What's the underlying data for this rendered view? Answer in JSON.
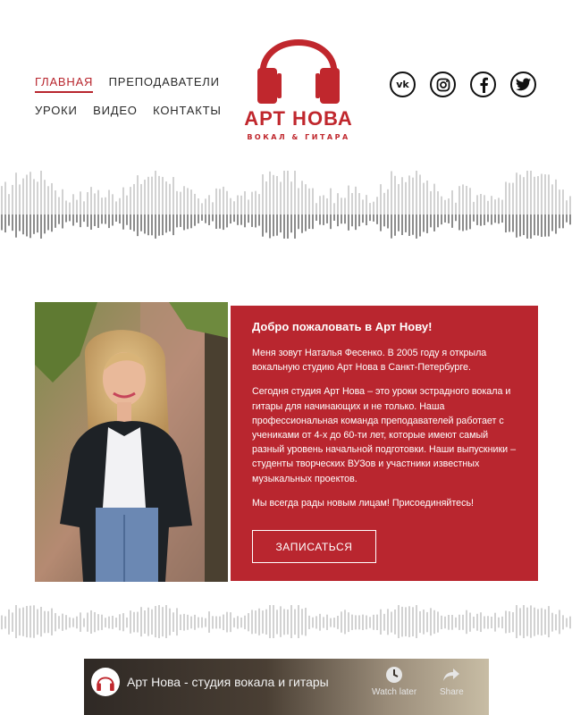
{
  "nav": {
    "row1": [
      {
        "label": "ГЛАВНАЯ",
        "active": true
      },
      {
        "label": "ПРЕПОДАВАТЕЛИ",
        "active": false
      }
    ],
    "row2": [
      {
        "label": "УРОКИ",
        "active": false
      },
      {
        "label": "ВИДЕО",
        "active": false
      },
      {
        "label": "КОНТАКТЫ",
        "active": false
      }
    ]
  },
  "logo": {
    "title": "АРТ НОВА",
    "subtitle": "ВОКАЛ & ГИТАРА",
    "icon": "headphones-icon"
  },
  "socials": [
    {
      "name": "vk-icon",
      "glyph": "vk"
    },
    {
      "name": "instagram-icon"
    },
    {
      "name": "facebook-icon"
    },
    {
      "name": "twitter-icon"
    }
  ],
  "welcome": {
    "title": "Добро пожаловать в Арт Нову!",
    "paragraphs": [
      "Меня зовут Наталья Фесенко. В 2005 году я открыла вокальную студию Арт Нова в Санкт-Петербурге.",
      "Сегодня студия Арт Нова – это уроки эстрадного вокала и гитары для начинающих и не только. Наша профессиональная команда преподавателей работает с учениками от 4-х до 60-ти лет, которые имеют самый разный уровень начальной подготовки. Наши выпускники – студенты творческих ВУЗов и участники известных музыкальных проектов.",
      "Мы всегда рады новым лицам! Присоединяйтесь!"
    ],
    "cta_label": "ЗАПИСАТЬСЯ"
  },
  "video": {
    "title": "Арт Нова - студия вокала и гитары",
    "watch_later": "Watch later",
    "share": "Share"
  },
  "colors": {
    "brand_red": "#b9262f",
    "logo_red": "#c0272d",
    "wave_light": "#d2d2d2",
    "wave_dark": "#8c8c8c"
  }
}
